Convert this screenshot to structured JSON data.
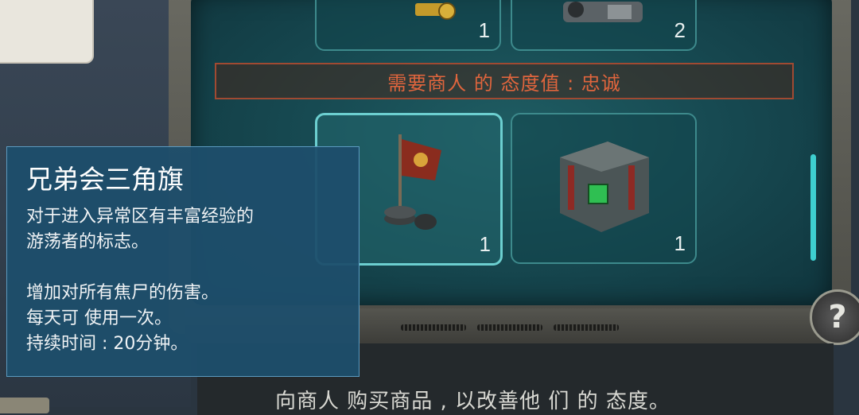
{
  "shop": {
    "top_items": [
      {
        "name": "key-item",
        "count": "1"
      },
      {
        "name": "mechanism-item",
        "count": "2"
      }
    ],
    "requirement_banner": "需要商人 的 态度值 : 忠诚",
    "items": [
      {
        "name": "brotherhood-pennant",
        "count": "1"
      },
      {
        "name": "loot-crate",
        "count": "1"
      }
    ]
  },
  "tooltip": {
    "title": "兄弟会三角旗",
    "desc_line1": "对于进入异常区有丰富经验的",
    "desc_line2": "游荡者的标志。",
    "effect_line1": "增加对所有焦尸的伤害。",
    "effect_line2": "每天可 使用一次。",
    "effect_line3": "持续时间 : 20分钟。"
  },
  "help_button": {
    "label": "?"
  },
  "footer": {
    "text": "向商人 购买商品 , 以改善他 们 的 态度。"
  },
  "colors": {
    "accent_cyan": "#6ccfd0",
    "banner_text": "#e0653d",
    "tooltip_bg": "#1e4e6c"
  }
}
